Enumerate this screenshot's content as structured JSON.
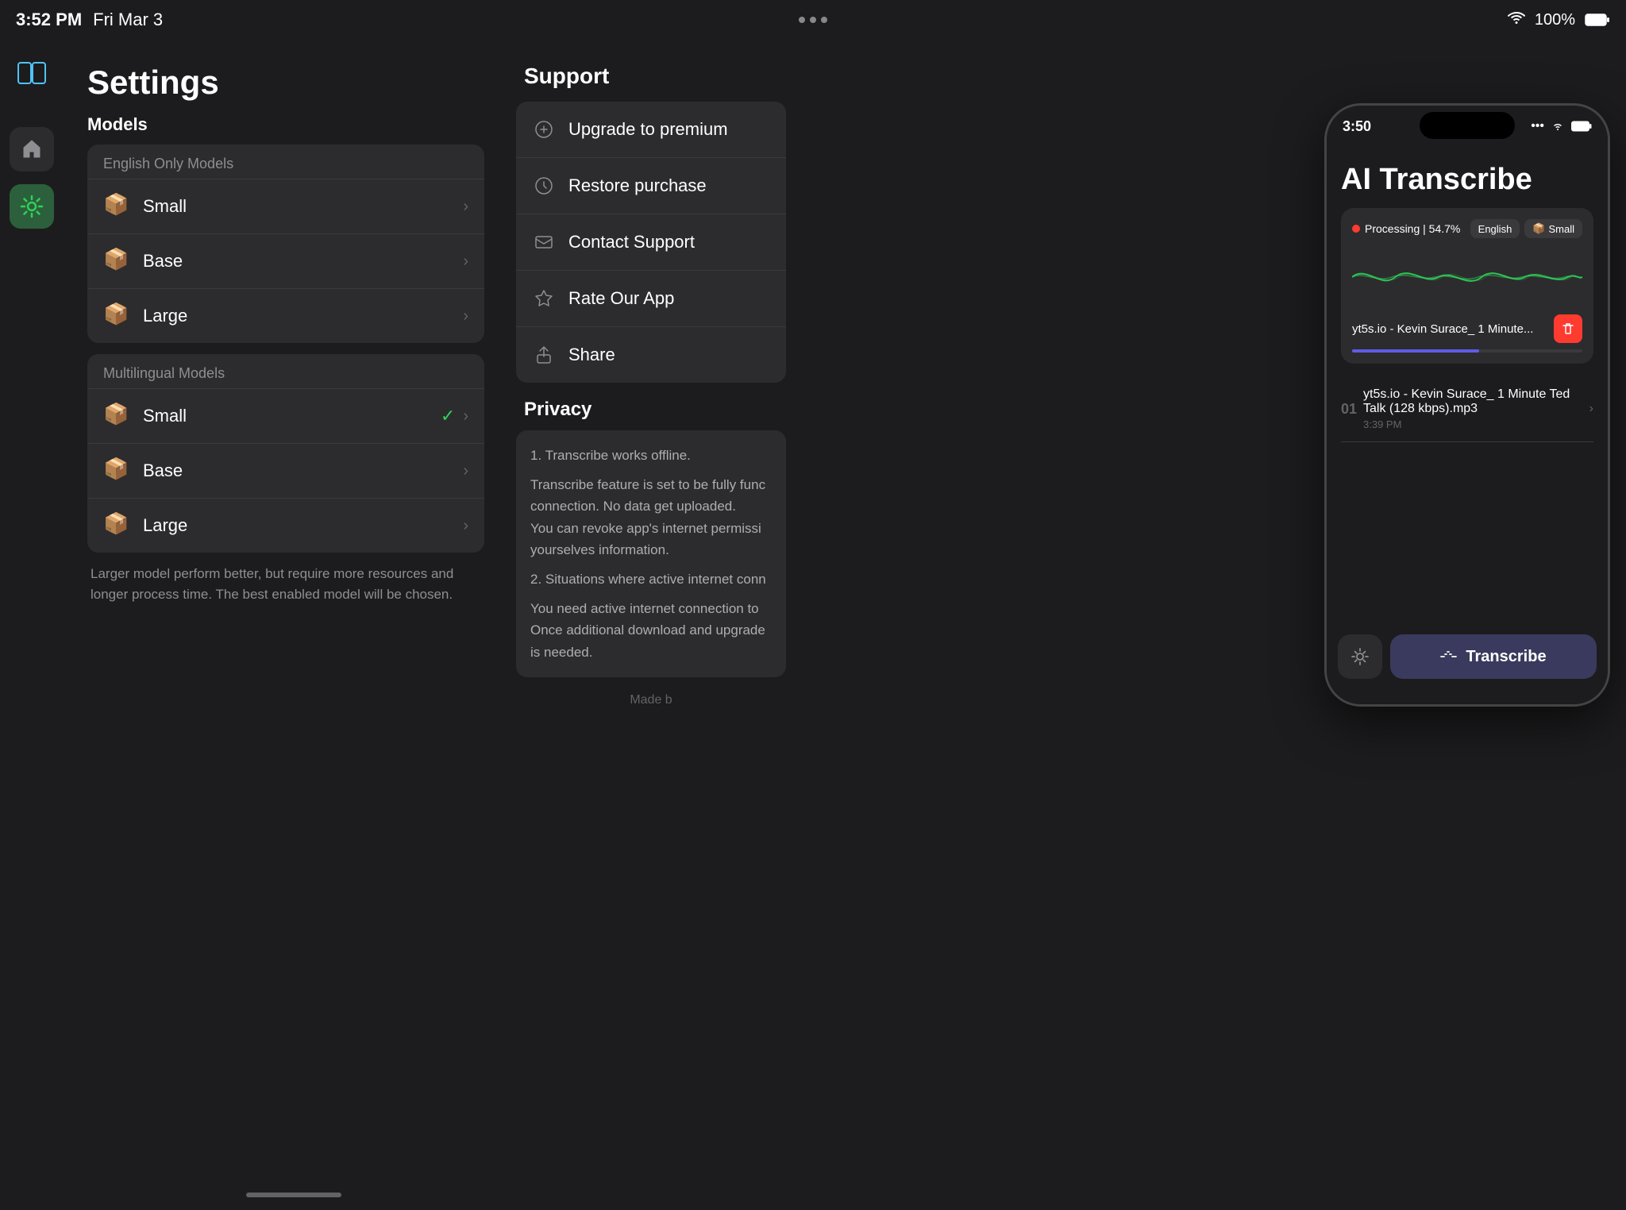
{
  "status_bar": {
    "time": "3:52 PM",
    "date": "Fri Mar 3",
    "wifi": "100%",
    "battery": "100%"
  },
  "sidebar": {
    "split_view_label": "Split View",
    "home_label": "Home",
    "settings_label": "Settings"
  },
  "settings": {
    "title": "Settings",
    "models_label": "Models",
    "english_only_label": "English Only Models",
    "multilingual_label": "Multilingual Models",
    "english_models": [
      {
        "name": "Small",
        "icon": "📦"
      },
      {
        "name": "Base",
        "icon": "📦"
      },
      {
        "name": "Large",
        "icon": "📦"
      }
    ],
    "multilingual_models": [
      {
        "name": "Small",
        "icon": "📦",
        "selected": true
      },
      {
        "name": "Base",
        "icon": "📦"
      },
      {
        "name": "Large",
        "icon": "📦"
      }
    ],
    "note": "Larger model perform better, but require more resources and longer process time. The best enabled model will be chosen."
  },
  "support": {
    "title": "Support",
    "items": [
      {
        "icon": "⚙️",
        "label": "Upgrade to premium"
      },
      {
        "icon": "⚙️",
        "label": "Restore purchase"
      },
      {
        "icon": "✉️",
        "label": "Contact Support"
      },
      {
        "icon": "☆",
        "label": "Rate Our App"
      },
      {
        "icon": "↑",
        "label": "Share"
      }
    ]
  },
  "privacy": {
    "title": "Privacy",
    "points": [
      "1. Transcribe works offline.",
      "Transcribe feature is set to be fully func connection. No data get uploaded. You can revoke app's internet permissi yourselves information.",
      "2. Situations where active internet conn",
      "You need active internet connection to Once additional download and upgrade is needed."
    ],
    "made_by": "Made b"
  },
  "phone": {
    "time": "3:50",
    "app_title": "AI Transcribe",
    "processing_label": "Processing | 54.7%",
    "language_tag": "English",
    "model_tag": "Small",
    "file_name": "yt5s.io - Kevin Surace_ 1 Minute...",
    "file_list": [
      {
        "number": "01",
        "title": "yt5s.io - Kevin Surace_ 1 Minute Ted Talk (128 kbps).mp3",
        "time": "3:39 PM"
      }
    ],
    "settings_btn_label": "Settings",
    "transcribe_btn_label": "Transcribe"
  }
}
